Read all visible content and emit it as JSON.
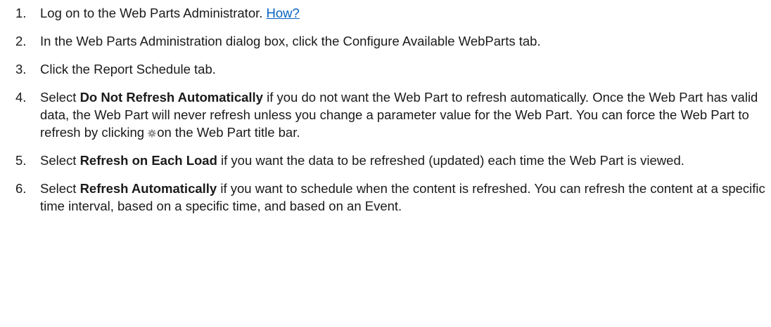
{
  "steps": [
    {
      "number": "1.",
      "text_before": "Log on to the Web Parts Administrator. ",
      "link": "How?"
    },
    {
      "number": "2.",
      "text": "In the Web Parts Administration dialog box, click the Configure Available WebParts tab."
    },
    {
      "number": "3.",
      "text": "Click the Report Schedule tab."
    },
    {
      "number": "4.",
      "prefix": "Select ",
      "bold": "Do Not Refresh Automatically",
      "text_after": " if you do not want the Web Part to refresh automatically. Once the Web Part has valid data, the Web Part will never refresh unless you change a parameter value for the Web Part. You can force the Web Part to refresh by clicking ",
      "icon": "refresh-gear-icon",
      "text_end": "on the Web Part title bar."
    },
    {
      "number": "5.",
      "prefix": "Select ",
      "bold": "Refresh on Each Load",
      "text_after": " if you want the data to be refreshed (updated) each time the Web Part is viewed."
    },
    {
      "number": "6.",
      "prefix": "Select ",
      "bold": "Refresh Automatically",
      "text_after": " if you want to schedule when the content is refreshed. You can refresh the content at a specific time interval, based on a specific time, and based on an Event."
    }
  ],
  "colors": {
    "text": "#1a1a1a",
    "link": "#0563c1"
  }
}
